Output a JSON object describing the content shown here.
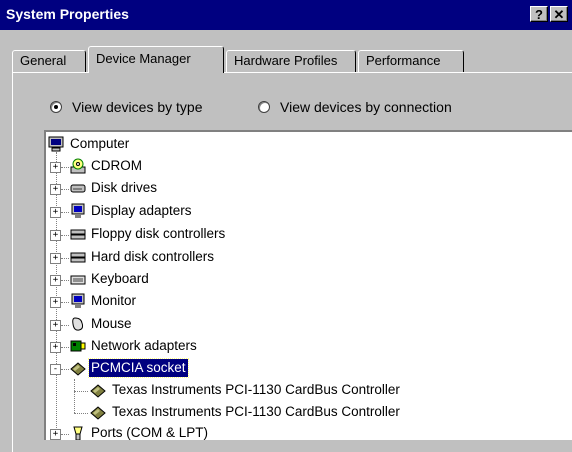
{
  "window": {
    "title": "System Properties",
    "help_label": "?",
    "close_label": "✕"
  },
  "tabs": [
    {
      "label": "General"
    },
    {
      "label": "Device Manager"
    },
    {
      "label": "Hardware Profiles"
    },
    {
      "label": "Performance"
    }
  ],
  "view": {
    "by_type": "View devices by type",
    "by_connection": "View devices by connection",
    "selected": "by_type"
  },
  "tree": {
    "root": "Computer",
    "items": [
      {
        "label": "CDROM",
        "icon": "cdrom-icon",
        "state": "+"
      },
      {
        "label": "Disk drives",
        "icon": "disk-drive-icon",
        "state": "+"
      },
      {
        "label": "Display adapters",
        "icon": "display-adapter-icon",
        "state": "+"
      },
      {
        "label": "Floppy disk controllers",
        "icon": "floppy-controller-icon",
        "state": "+"
      },
      {
        "label": "Hard disk controllers",
        "icon": "hard-disk-controller-icon",
        "state": "+"
      },
      {
        "label": "Keyboard",
        "icon": "keyboard-icon",
        "state": "+"
      },
      {
        "label": "Monitor",
        "icon": "monitor-icon",
        "state": "+"
      },
      {
        "label": "Mouse",
        "icon": "mouse-icon",
        "state": "+"
      },
      {
        "label": "Network adapters",
        "icon": "network-adapter-icon",
        "state": "+"
      },
      {
        "label": "PCMCIA socket",
        "icon": "pcmcia-icon",
        "state": "-",
        "selected": true
      },
      {
        "label": "Ports (COM & LPT)",
        "icon": "ports-icon",
        "state": "+"
      }
    ],
    "children": [
      {
        "label": "Texas Instruments PCI-1130 CardBus Controller",
        "icon": "pcmcia-icon"
      },
      {
        "label": "Texas Instruments PCI-1130 CardBus Controller",
        "icon": "pcmcia-icon"
      }
    ]
  },
  "colors": {
    "titlebar": "#000080",
    "face": "#c0c0c0",
    "selection": "#000080"
  }
}
